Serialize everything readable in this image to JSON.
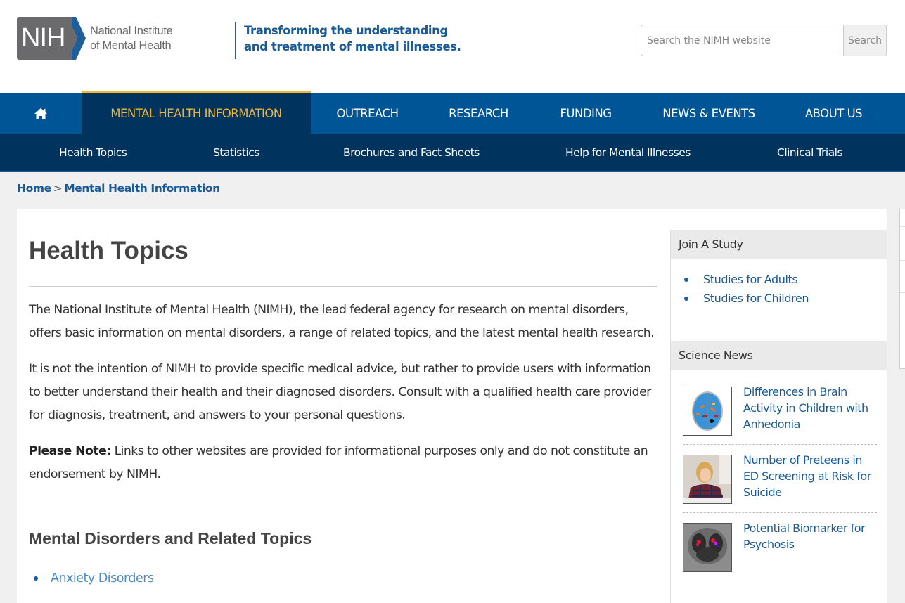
{
  "header": {
    "logo_mark": "NIH",
    "logo_name_line1": "National Institute",
    "logo_name_line2": "of Mental Health",
    "tagline_line1": "Transforming the understanding",
    "tagline_line2": "and treatment of mental illnesses.",
    "search": {
      "placeholder": "Search the NIMH website",
      "value": "",
      "button_label": "Search"
    }
  },
  "main_nav": {
    "home_icon": "home-icon",
    "items": [
      {
        "label": "MENTAL HEALTH INFORMATION",
        "active": true
      },
      {
        "label": "OUTREACH"
      },
      {
        "label": "RESEARCH"
      },
      {
        "label": "FUNDING"
      },
      {
        "label": "NEWS & EVENTS"
      },
      {
        "label": "ABOUT US"
      }
    ]
  },
  "sub_nav": {
    "items": [
      {
        "label": "Health Topics"
      },
      {
        "label": "Statistics"
      },
      {
        "label": "Brochures and Fact Sheets"
      },
      {
        "label": "Help for Mental Illnesses"
      },
      {
        "label": "Clinical Trials"
      }
    ]
  },
  "breadcrumb": {
    "items": [
      "Home",
      "Mental Health Information"
    ],
    "separator": ">"
  },
  "main": {
    "title": "Health Topics",
    "paragraphs": [
      "The National Institute of Mental Health (NIMH), the lead federal agency for research on mental disorders, offers basic information on mental disorders, a range of related topics, and the latest mental health research.",
      "It is not the intention of NIMH to provide specific medical advice, but rather to provide users with information to better understand their health and their diagnosed disorders. Consult with a qualified health care provider for diagnosis, treatment, and answers to your personal questions."
    ],
    "note_label": "Please Note:",
    "note_text": " Links to other websites are provided for informational purposes only and do not constitute an endorsement by NIMH.",
    "section_title": "Mental Disorders and Related Topics",
    "topics": [
      "Anxiety Disorders"
    ]
  },
  "sidebar": {
    "join_study": {
      "title": "Join A Study",
      "links": [
        "Studies for Adults",
        "Studies for Children"
      ]
    },
    "science_news": {
      "title": "Science News",
      "items": [
        {
          "title": "Differences in Brain Activity in Children with Anhedonia",
          "thumb": "brain-scan-image"
        },
        {
          "title": "Number of Preteens in ED Screening at Risk for Suicide",
          "thumb": "distressed-girl-photo"
        },
        {
          "title": "Potential Biomarker for Psychosis",
          "thumb": "mri-biomarker-image"
        }
      ]
    }
  },
  "colors": {
    "primary_blue": "#005596",
    "dark_navy": "#00345f",
    "accent_gold": "#f2b632",
    "link_blue": "#1a5a97",
    "topic_link": "#4a8cc9"
  }
}
